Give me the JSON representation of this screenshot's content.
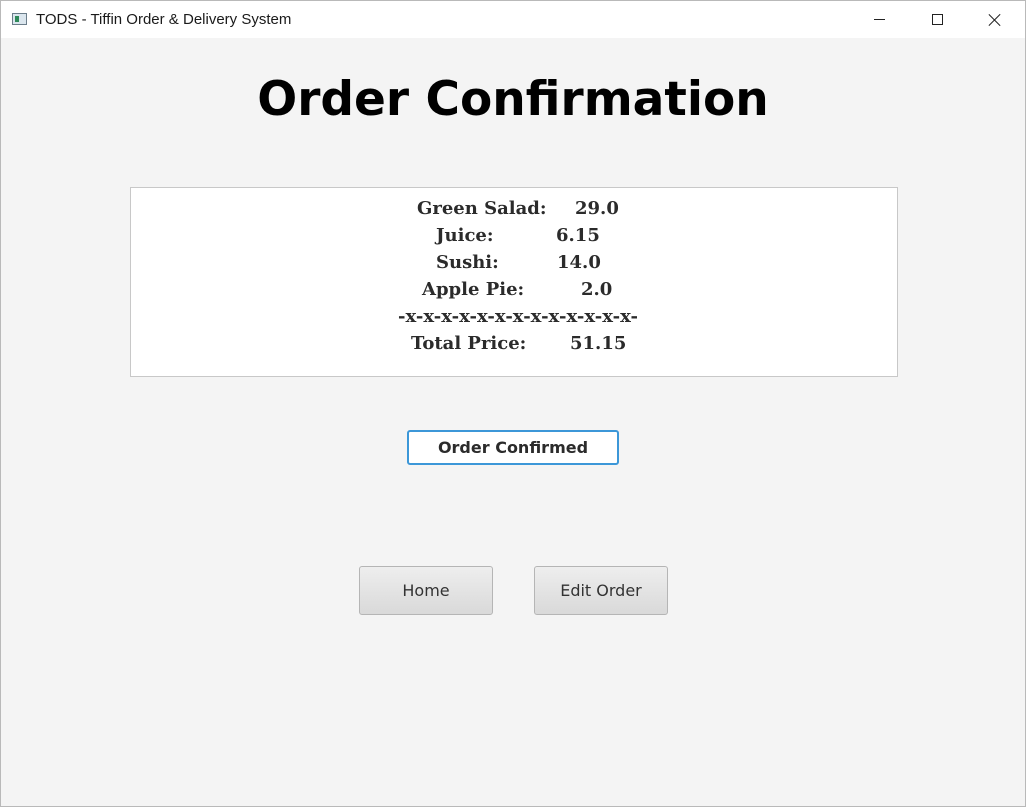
{
  "window": {
    "title": "TODS - Tiffin Order & Delivery System"
  },
  "heading": "Order Confirmation",
  "summary": {
    "items": [
      {
        "name": "Green Salad:",
        "price": "29.0"
      },
      {
        "name": "Juice:",
        "price": "6.15"
      },
      {
        "name": "Sushi:",
        "price": "14.0"
      },
      {
        "name": "Apple Pie:",
        "price": "2.0"
      }
    ],
    "separator": "-x-x-x-x-x-x-x-x-x-x-x-x-x-",
    "total_label": "Total Price:",
    "total_value": "51.15"
  },
  "buttons": {
    "confirm": "Order Confirmed",
    "home": "Home",
    "edit": "Edit Order"
  },
  "icons": {
    "app": "app-icon",
    "minimize": "minimize-icon",
    "maximize": "maximize-icon",
    "close": "close-icon"
  },
  "colors": {
    "accent": "#3c97d8",
    "background": "#f4f4f4"
  }
}
